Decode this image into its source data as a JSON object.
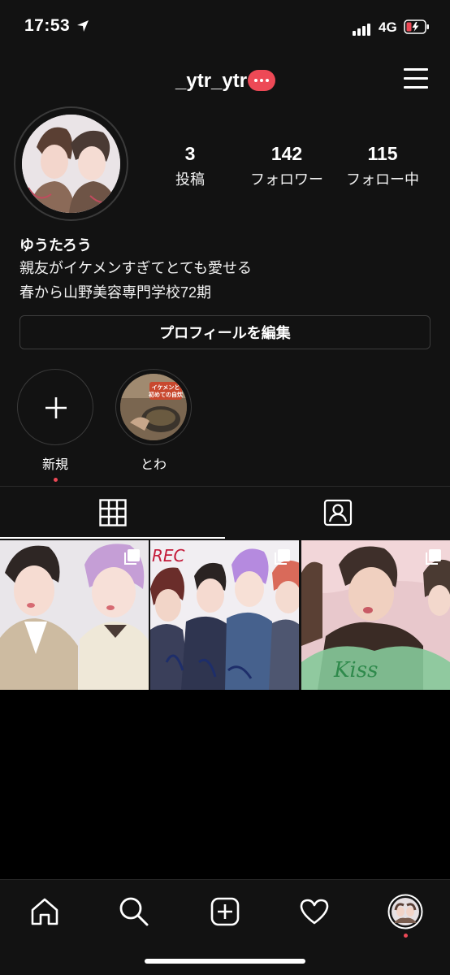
{
  "status_bar": {
    "time": "17:53",
    "network": "4G"
  },
  "header": {
    "username": "_ytr_ytr"
  },
  "stats": [
    {
      "value": "3",
      "label": "投稿"
    },
    {
      "value": "142",
      "label": "フォロワー"
    },
    {
      "value": "115",
      "label": "フォロー中"
    }
  ],
  "bio": {
    "name": "ゆうたろう",
    "lines": [
      "親友がイケメンすぎてとても愛せる",
      "春から山野美容専門学校72期"
    ]
  },
  "edit_profile_label": "プロフィールを編集",
  "highlights": [
    {
      "label": "新規",
      "icon": "plus-icon"
    },
    {
      "label": "とわ",
      "icon": "highlight-thumbnail"
    }
  ],
  "highlight_thumb_text": [
    "イケメンと",
    "初めての自炊"
  ],
  "tabs": [
    {
      "icon": "grid-icon",
      "active": true
    },
    {
      "icon": "tagged-icon",
      "active": false
    }
  ],
  "posts": [
    {
      "type": "carousel"
    },
    {
      "type": "carousel",
      "overlay_text": "REC"
    },
    {
      "type": "carousel",
      "overlay_text": "Kiss"
    }
  ],
  "nav": [
    "home-icon",
    "search-icon",
    "new-post-icon",
    "activity-icon",
    "profile-avatar"
  ],
  "colors": {
    "background": "#121212",
    "accent": "#ed4956",
    "border": "#3a3a3a"
  }
}
